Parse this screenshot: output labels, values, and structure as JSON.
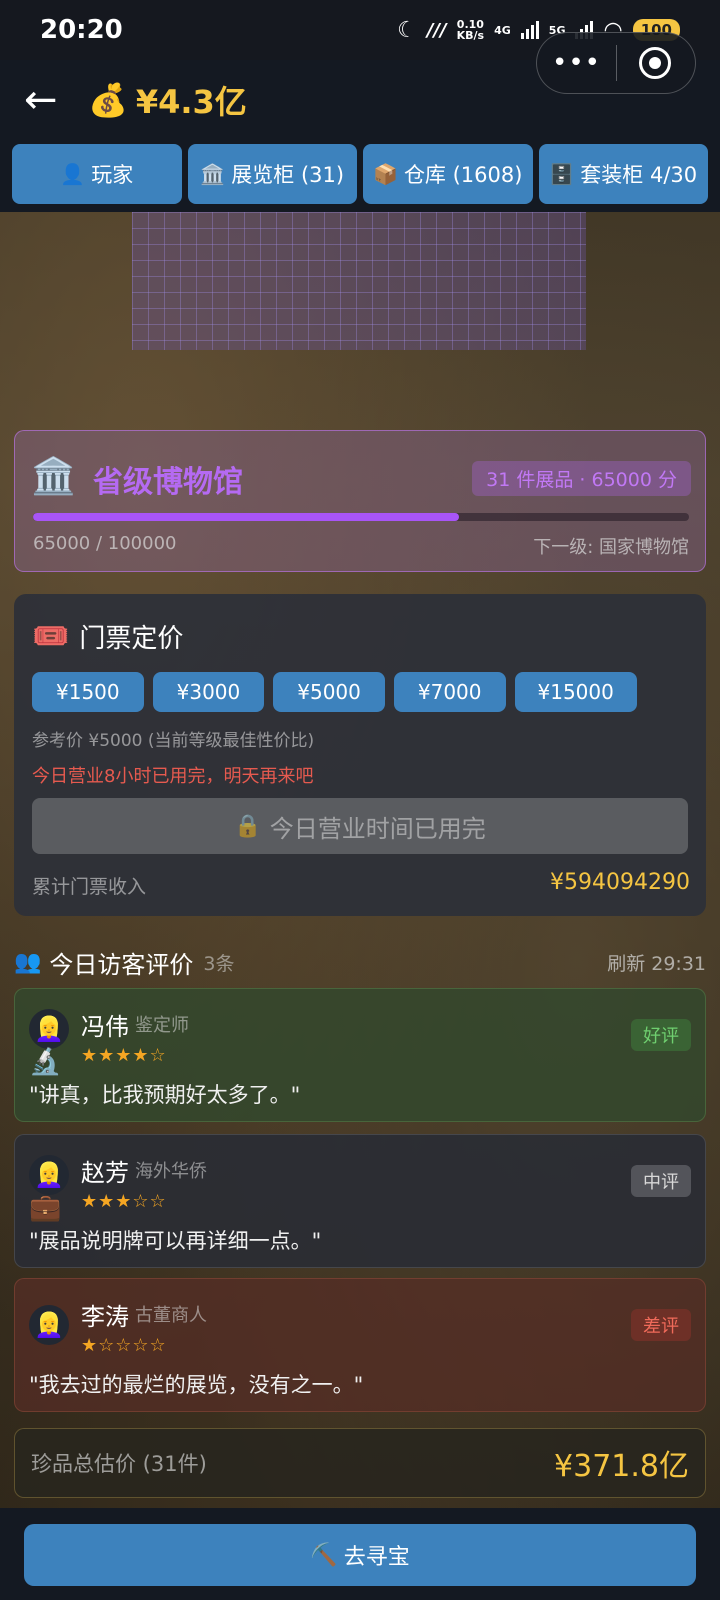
{
  "status": {
    "time": "20:20",
    "net_speed": "0.10",
    "net_unit": "KB/s",
    "sig1": "4G",
    "sig2": "5G",
    "battery": "100"
  },
  "header": {
    "money_icon": "💰",
    "money": "¥4.3亿"
  },
  "tabs": [
    {
      "icon": "👤",
      "label": "玩家"
    },
    {
      "icon": "🏛️",
      "label": "展览柜 (31)"
    },
    {
      "icon": "📦",
      "label": "仓库 (1608)"
    },
    {
      "icon": "🗄️",
      "label": "套装柜 4/30"
    }
  ],
  "museum": {
    "icon": "🏛️",
    "title": "省级博物馆",
    "badge": "31 件展品 · 65000 分",
    "progress_text": "65000 / 100000",
    "progress_fraction": 0.65,
    "next_level": "下一级: 国家博物馆"
  },
  "ticket": {
    "icon": "🎟️",
    "title": "门票定价",
    "prices": [
      "¥1500",
      "¥3000",
      "¥5000",
      "¥7000",
      "¥15000"
    ],
    "reference": "参考价 ¥5000 (当前等级最佳性价比)",
    "warning": "今日营业8小时已用完，明天再来吧",
    "disabled_icon": "🔒",
    "disabled_label": "今日营业时间已用完",
    "income_label": "累计门票收入",
    "income_value": "¥594094290"
  },
  "visitors": {
    "icon": "👥",
    "title": "今日访客评价",
    "count": "3条",
    "refresh": "刷新 29:31",
    "reviews": [
      {
        "avatar": "👱‍♀️",
        "role_icon": "🔬",
        "name": "冯伟",
        "role": "鉴定师",
        "stars": "★★★★☆",
        "badge": "好评",
        "quote": "\"讲真，比我预期好太多了。\""
      },
      {
        "avatar": "👱‍♀️",
        "role_icon": "💼",
        "name": "赵芳",
        "role": "海外华侨",
        "stars": "★★★☆☆",
        "badge": "中评",
        "quote": "\"展品说明牌可以再详细一点。\""
      },
      {
        "avatar": "👱‍♀️",
        "role_icon": "",
        "name": "李涛",
        "role": "古董商人",
        "stars": "★☆☆☆☆",
        "badge": "差评",
        "quote": "\"我去过的最烂的展览，没有之一。\""
      }
    ]
  },
  "total": {
    "label": "珍品总估价 (31件)",
    "value": "¥371.8亿"
  },
  "action": {
    "icon": "⛏️",
    "label": "去寻宝"
  },
  "colors": {
    "accent_blue": "#3d82bd",
    "gold": "#f5c542",
    "museum_purple": "#a855f7",
    "warning_red": "#e65a4f"
  }
}
